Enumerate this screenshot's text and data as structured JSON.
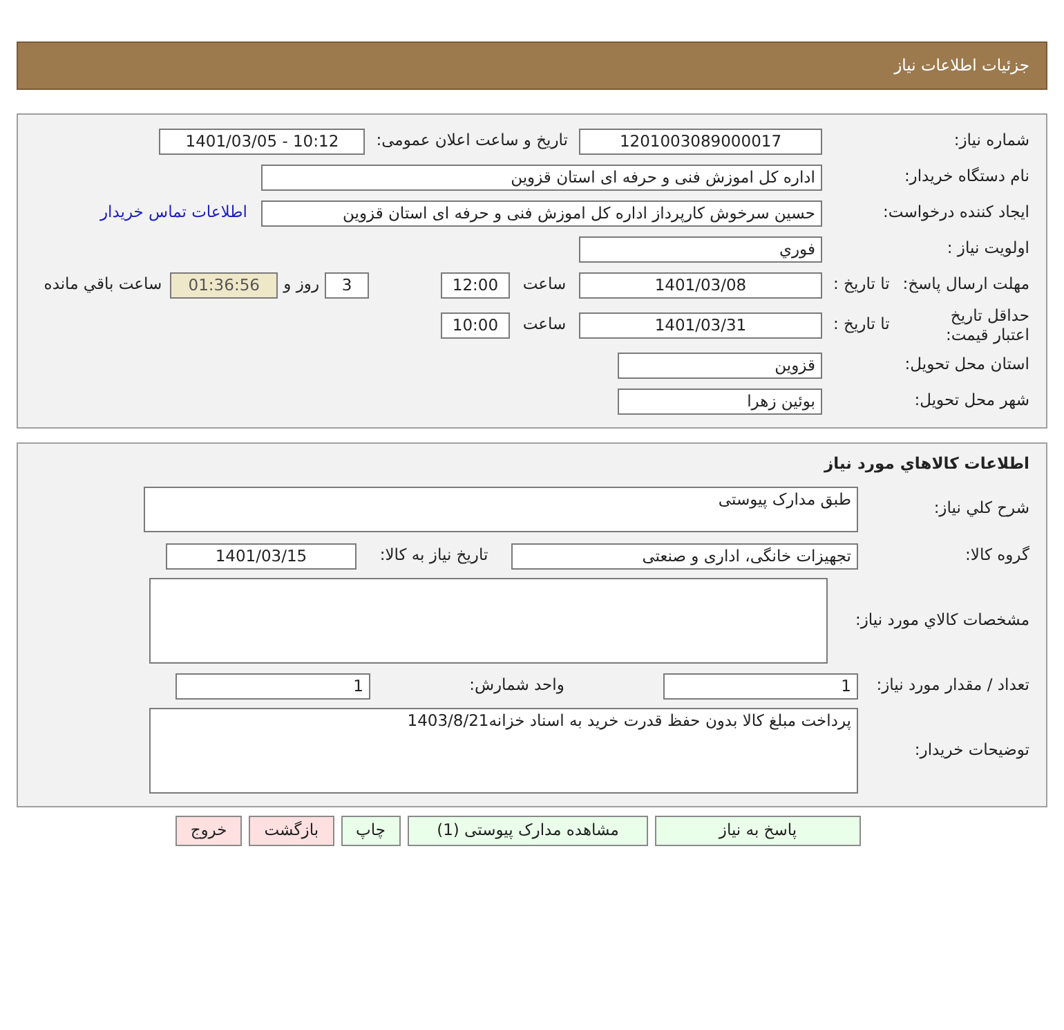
{
  "header": {
    "title": "جزئیات اطلاعات نیاز"
  },
  "details": {
    "need_number": {
      "label": "شماره نیاز:",
      "value": "1201003089000017"
    },
    "announce": {
      "label": "تاریخ و ساعت اعلان عمومی:",
      "value": "1401/03/05 - 10:12"
    },
    "buyer": {
      "label": "نام دستگاه خریدار:",
      "value": "اداره کل اموزش فنی و حرفه ای استان قزوین"
    },
    "requester": {
      "label": "ایجاد کننده درخواست:",
      "value": "حسین سرخوش کارپرداز اداره کل اموزش فنی و حرفه ای استان قزوین",
      "link": "اطلاعات تماس خریدار"
    },
    "priority": {
      "label": "اولویت نیاز :",
      "value": "فوري"
    },
    "deadline": {
      "label": "مهلت ارسال پاسخ:",
      "sub_label": "تا تاریخ :",
      "date": "1401/03/08",
      "time_label": "ساعت",
      "time": "12:00",
      "days": "3",
      "days_label": "روز و",
      "remaining": "01:36:56",
      "remaining_label": "ساعت باقي مانده"
    },
    "validity": {
      "label": "حداقل تاریخ اعتبار قیمت:",
      "sub_label": "تا تاریخ :",
      "date": "1401/03/31",
      "time_label": "ساعت",
      "time": "10:00"
    },
    "province": {
      "label": "استان محل تحویل:",
      "value": "قزوین"
    },
    "city": {
      "label": "شهر محل تحویل:",
      "value": "بوئین زهرا"
    }
  },
  "goods": {
    "title": "اطلاعات کالاهاي مورد نیاز",
    "description": {
      "label": "شرح کلي نیاز:",
      "value": "طبق مدارک پیوستی"
    },
    "group": {
      "label": "گروه کالا:",
      "value": "تجهیزات خانگی، اداری و صنعتی"
    },
    "need_date": {
      "label": "تاریخ نیاز به کالا:",
      "value": "1401/03/15"
    },
    "specs": {
      "label": "مشخصات کالاي مورد نیاز:"
    },
    "quantity": {
      "label": "تعداد / مقدار مورد نیاز:",
      "value": "1"
    },
    "unit": {
      "label": "واحد شمارش:",
      "value": "1"
    },
    "notes": {
      "label": "توضیحات خریدار:",
      "value": "پرداخت مبلغ کالا بدون حفظ قدرت خرید به اسناد خزانه1403/8/21"
    }
  },
  "buttons": [
    {
      "label": "پاسخ به نیاز",
      "kind": "normal"
    },
    {
      "label": "مشاهده مدارک پیوستی (1)",
      "kind": "normal"
    },
    {
      "label": "چاپ",
      "kind": "normal"
    },
    {
      "label": "بازگشت",
      "kind": "danger"
    },
    {
      "label": "خروج",
      "kind": "danger"
    }
  ]
}
